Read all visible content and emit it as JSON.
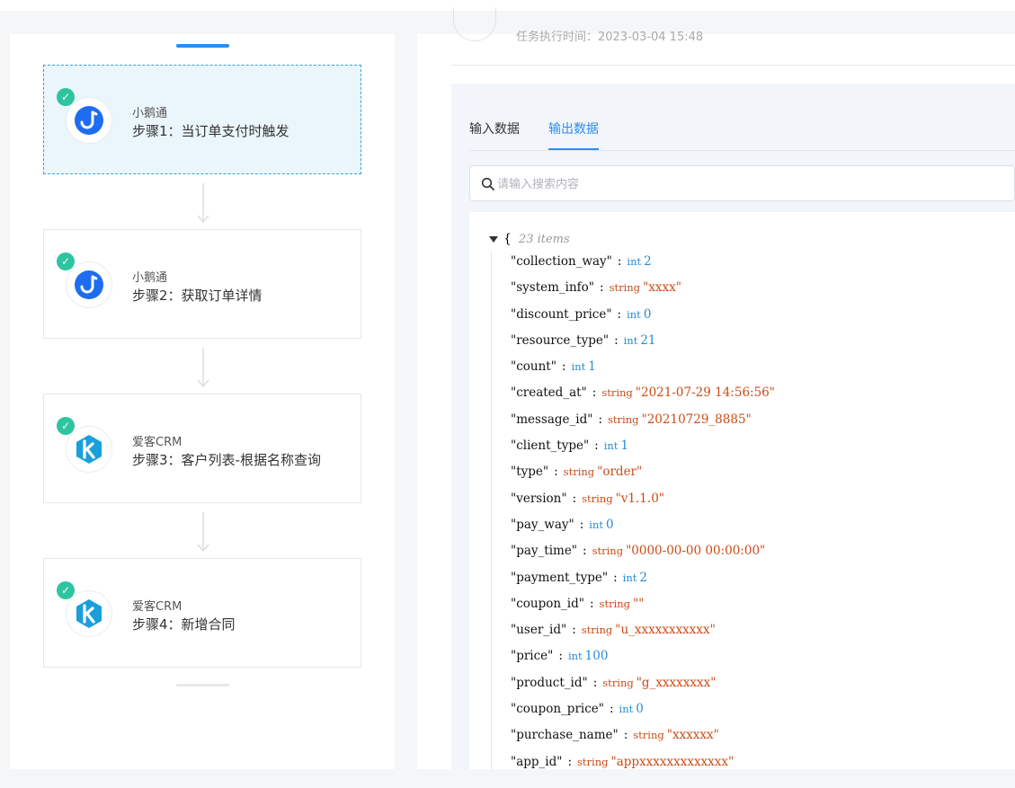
{
  "workflow": {
    "steps": [
      {
        "app": "小鹅通",
        "title": "步骤1：当订单支付时触发",
        "logo": "goose-icon",
        "active": true
      },
      {
        "app": "小鹅通",
        "title": "步骤2：获取订单详情",
        "logo": "goose-icon",
        "active": false
      },
      {
        "app": "爱客CRM",
        "title": "步骤3：客户列表-根据名称查询",
        "logo": "k-crm-icon",
        "active": false
      },
      {
        "app": "爱客CRM",
        "title": "步骤4：新增合同",
        "logo": "k-crm-icon",
        "active": false
      }
    ]
  },
  "detail": {
    "time_hint": "任务执行时间：2023-03-04 15:48",
    "tabs": {
      "input": "输入数据",
      "output": "输出数据",
      "active": "output"
    },
    "search": {
      "placeholder": "请输入搜索内容",
      "value": ""
    },
    "json": {
      "open_brace": "{",
      "items_label": "23 items",
      "rows": [
        {
          "key": "\"collection_way\"",
          "type": "int",
          "value": "2"
        },
        {
          "key": "\"system_info\"",
          "type": "string",
          "value": "\"xxxx\""
        },
        {
          "key": "\"discount_price\"",
          "type": "int",
          "value": "0"
        },
        {
          "key": "\"resource_type\"",
          "type": "int",
          "value": "21"
        },
        {
          "key": "\"count\"",
          "type": "int",
          "value": "1"
        },
        {
          "key": "\"created_at\"",
          "type": "string",
          "value": "\"2021-07-29 14:56:56\""
        },
        {
          "key": "\"message_id\"",
          "type": "string",
          "value": "\"20210729_8885\""
        },
        {
          "key": "\"client_type\"",
          "type": "int",
          "value": "1"
        },
        {
          "key": "\"type\"",
          "type": "string",
          "value": "\"order\""
        },
        {
          "key": "\"version\"",
          "type": "string",
          "value": "\"v1.1.0\""
        },
        {
          "key": "\"pay_way\"",
          "type": "int",
          "value": "0"
        },
        {
          "key": "\"pay_time\"",
          "type": "string",
          "value": "\"0000-00-00 00:00:00\""
        },
        {
          "key": "\"payment_type\"",
          "type": "int",
          "value": "2"
        },
        {
          "key": "\"coupon_id\"",
          "type": "string",
          "value": "\"\""
        },
        {
          "key": "\"user_id\"",
          "type": "string",
          "value": "\"u_xxxxxxxxxxx\""
        },
        {
          "key": "\"price\"",
          "type": "int",
          "value": "100"
        },
        {
          "key": "\"product_id\"",
          "type": "string",
          "value": "\"g_xxxxxxxx\""
        },
        {
          "key": "\"coupon_price\"",
          "type": "int",
          "value": "0"
        },
        {
          "key": "\"purchase_name\"",
          "type": "string",
          "value": "\"xxxxxx\""
        },
        {
          "key": "\"app_id\"",
          "type": "string",
          "value": "\"appxxxxxxxxxxxxx\""
        }
      ]
    }
  },
  "colors": {
    "accent": "#2d8cf0",
    "success": "#2ec4a0",
    "int_value": "#268bd2",
    "string_value": "#cb4b16",
    "active_step_bg": "#eaf5fc"
  }
}
